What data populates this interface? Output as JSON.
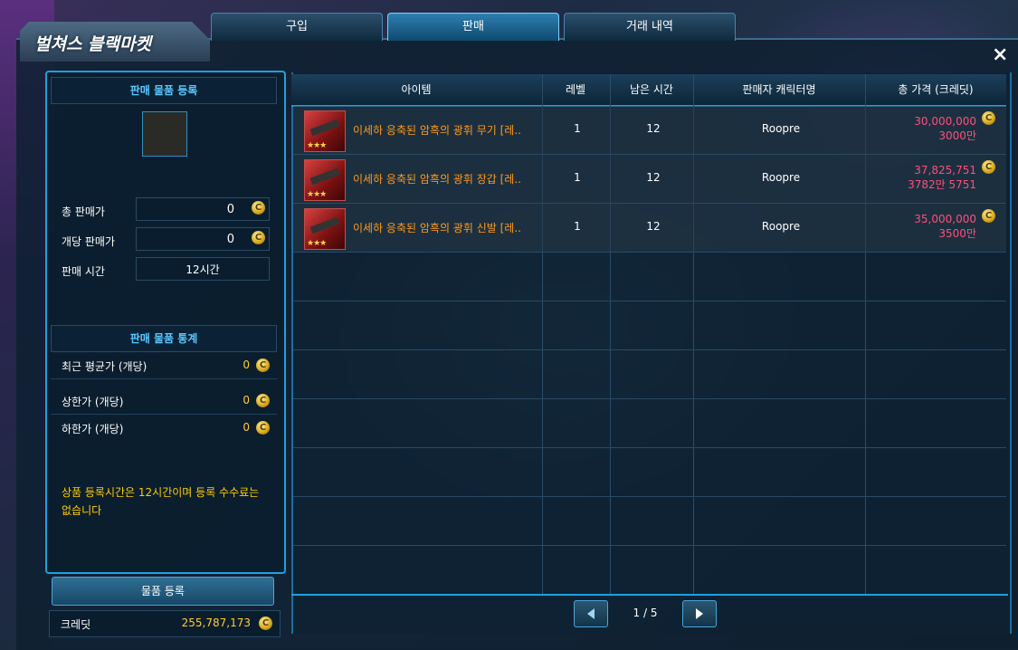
{
  "window": {
    "title": "벌쳐스 블랙마켓",
    "close_label": "×"
  },
  "tabs": [
    {
      "label": "구입",
      "active": false
    },
    {
      "label": "판매",
      "active": true
    },
    {
      "label": "거래 내역",
      "active": false
    }
  ],
  "register": {
    "title": "판매 물품 등록",
    "total_price_label": "총 판매가",
    "total_price_value": "0",
    "unit_price_label": "개당 판매가",
    "unit_price_value": "0",
    "time_label": "판매 시간",
    "time_value": "12시간"
  },
  "stats": {
    "title": "판매 물품 통계",
    "rows": [
      {
        "label": "최근 평균가 (개당)",
        "value": "0"
      },
      {
        "label": "상한가 (개당)",
        "value": "0"
      },
      {
        "label": "하한가 (개당)",
        "value": "0"
      }
    ]
  },
  "notice": "상품 등록시간은 12시간이며 등록 수수료는 없습니다",
  "register_button": "물품 등록",
  "credit": {
    "label": "크레딧",
    "value": "255,787,173"
  },
  "coin_symbol": "C",
  "table": {
    "headers": [
      "아이템",
      "레벨",
      "남은 시간",
      "판매자 캐릭터명",
      "총 가격 (크레딧)"
    ],
    "rows": [
      {
        "name": "이세하 응축된 암흑의 광휘 무기 [레..",
        "stars": "★★★",
        "level": "1",
        "time": "12",
        "seller": "Roopre",
        "price": "30,000,000",
        "price_sub": "3000만"
      },
      {
        "name": "이세하 응축된 암흑의 광휘 장갑 [레..",
        "stars": "★★★",
        "level": "1",
        "time": "12",
        "seller": "Roopre",
        "price": "37,825,751",
        "price_sub": "3782만 5751"
      },
      {
        "name": "이세하 응축된 암흑의 광휘 신발 [레..",
        "stars": "★★★",
        "level": "1",
        "time": "12",
        "seller": "Roopre",
        "price": "35,000,000",
        "price_sub": "3500만"
      }
    ]
  },
  "pagination": {
    "text": "1 / 5"
  },
  "colors": {
    "accent": "#1ea0e0",
    "item_name": "#ff9a1a",
    "price": "#ff4f7a",
    "gold": "#ffcc33"
  }
}
